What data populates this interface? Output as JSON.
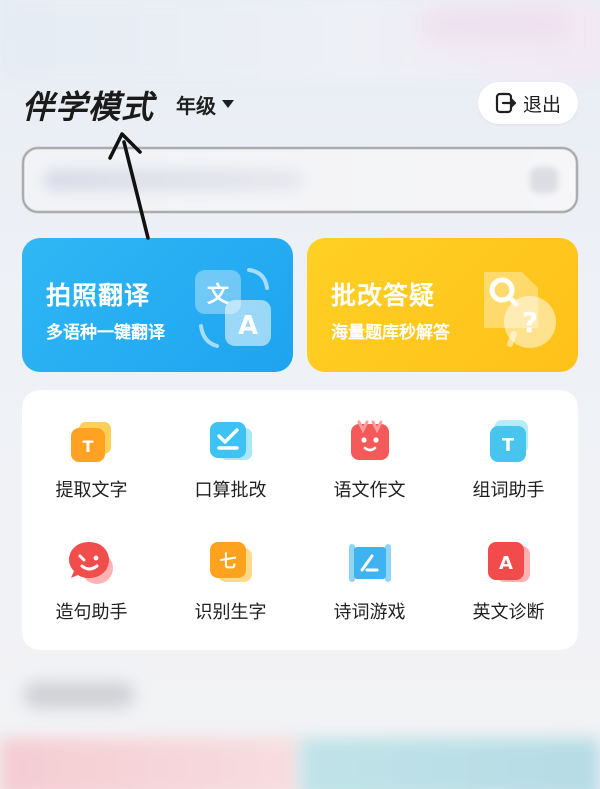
{
  "header": {
    "title": "伴学模式",
    "grade_label": "年级",
    "exit_label": "退出"
  },
  "feature_cards": [
    {
      "title": "拍照翻译",
      "subtitle": "多语种一键翻译",
      "icon": "translate-icon",
      "color": "#24aef3"
    },
    {
      "title": "批改答疑",
      "subtitle": "海量题库秒解答",
      "icon": "qa-icon",
      "color": "#ffc81f"
    }
  ],
  "tools": [
    {
      "label": "提取文字",
      "icon": "extract-text-icon"
    },
    {
      "label": "口算批改",
      "icon": "arithmetic-check-icon"
    },
    {
      "label": "语文作文",
      "icon": "chinese-essay-icon"
    },
    {
      "label": "组词助手",
      "icon": "word-builder-icon"
    },
    {
      "label": "造句助手",
      "icon": "sentence-helper-icon"
    },
    {
      "label": "识别生字",
      "icon": "recognize-char-icon"
    },
    {
      "label": "诗词游戏",
      "icon": "poetry-game-icon"
    },
    {
      "label": "英文诊断",
      "icon": "english-diagnosis-icon"
    }
  ],
  "colors": {
    "accent_blue": "#24aef3",
    "accent_yellow": "#ffc81f",
    "panel_bg": "#ffffff",
    "text": "#1f1f1f"
  }
}
